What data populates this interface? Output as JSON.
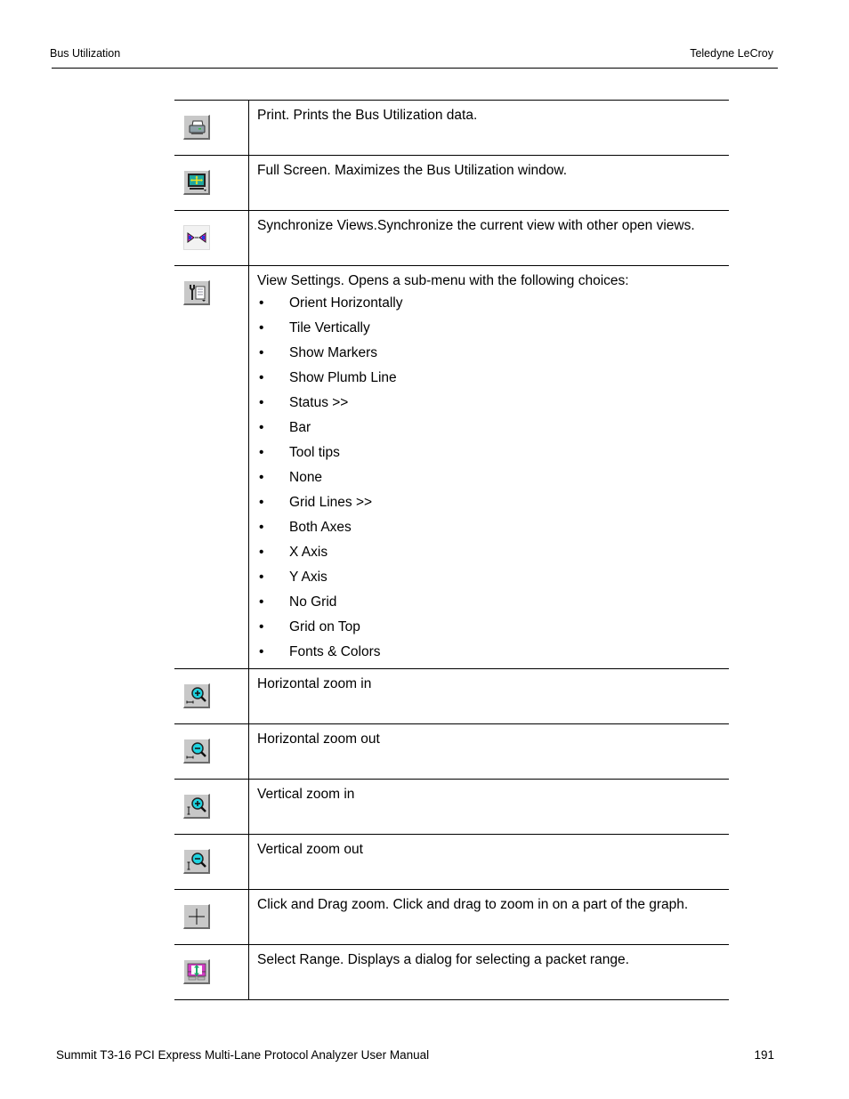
{
  "header": {
    "section": "Bus Utilization",
    "company": "Teledyne LeCroy"
  },
  "table": {
    "rows": [
      {
        "icon": "printer-icon",
        "text": "Print. Prints the Bus Utilization data."
      },
      {
        "icon": "full-screen-icon",
        "text": "Full Screen. Maximizes the Bus Utilization window."
      },
      {
        "icon": "synchronize-views-icon",
        "text": "Synchronize Views.Synchronize the current view with other open views."
      },
      {
        "icon": "view-settings-icon",
        "text": "View Settings. Opens a sub-menu with the following choices:",
        "bullet": "•",
        "choices": [
          "Orient Horizontally",
          "Tile Vertically",
          "Show Markers",
          "Show Plumb Line",
          "Status >>",
          "Bar",
          "Tool tips",
          "None",
          "Grid Lines >>",
          "Both Axes",
          "X Axis",
          "Y Axis",
          "No Grid",
          "Grid on Top",
          "Fonts & Colors"
        ]
      },
      {
        "icon": "horizontal-zoom-in-icon",
        "text": "Horizontal zoom in"
      },
      {
        "icon": "horizontal-zoom-out-icon",
        "text": "Horizontal zoom out"
      },
      {
        "icon": "vertical-zoom-in-icon",
        "text": "Vertical zoom in"
      },
      {
        "icon": "vertical-zoom-out-icon",
        "text": "Vertical zoom out"
      },
      {
        "icon": "click-drag-zoom-icon",
        "text": "Click and Drag zoom. Click and drag to zoom in on a part of the graph."
      },
      {
        "icon": "select-range-icon",
        "text": "Select Range. Displays a dialog for selecting a packet range."
      }
    ]
  },
  "footer": {
    "manual_title": "Summit T3-16 PCI Express Multi-Lane Protocol Analyzer User Manual",
    "page_number": "191"
  }
}
